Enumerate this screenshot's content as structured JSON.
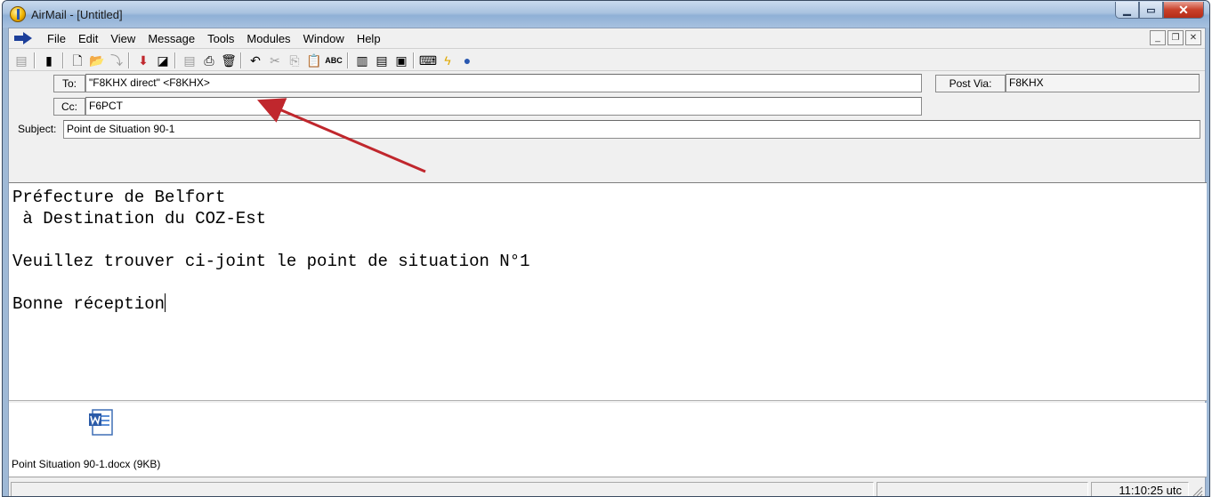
{
  "window": {
    "title": "AirMail - [Untitled]"
  },
  "menu": [
    {
      "label": "File"
    },
    {
      "label": "Edit"
    },
    {
      "label": "View"
    },
    {
      "label": "Message"
    },
    {
      "label": "Tools"
    },
    {
      "label": "Modules"
    },
    {
      "label": "Window"
    },
    {
      "label": "Help"
    }
  ],
  "header": {
    "to_label": "To:",
    "to_value": "\"F8KHX direct\" <F8KHX>",
    "cc_label": "Cc:",
    "cc_value": "F6PCT",
    "subject_label": "Subject:",
    "subject_value": "Point de Situation 90-1",
    "post_via_label": "Post Via:",
    "post_via_value": "F8KHX"
  },
  "body": {
    "lines": [
      "Préfecture de Belfort",
      " à Destination du COZ-Est",
      "",
      "Veuillez trouver ci-joint le point de situation N°1",
      "",
      "Bonne réception"
    ]
  },
  "attachment": {
    "label": "Point Situation 90-1.docx (9KB)",
    "icon": "word-document-icon"
  },
  "status": {
    "time": "11:10:25 utc"
  },
  "colors": {
    "annotation_arrow": "#c0272d",
    "title_bar": "#a9c2df"
  }
}
